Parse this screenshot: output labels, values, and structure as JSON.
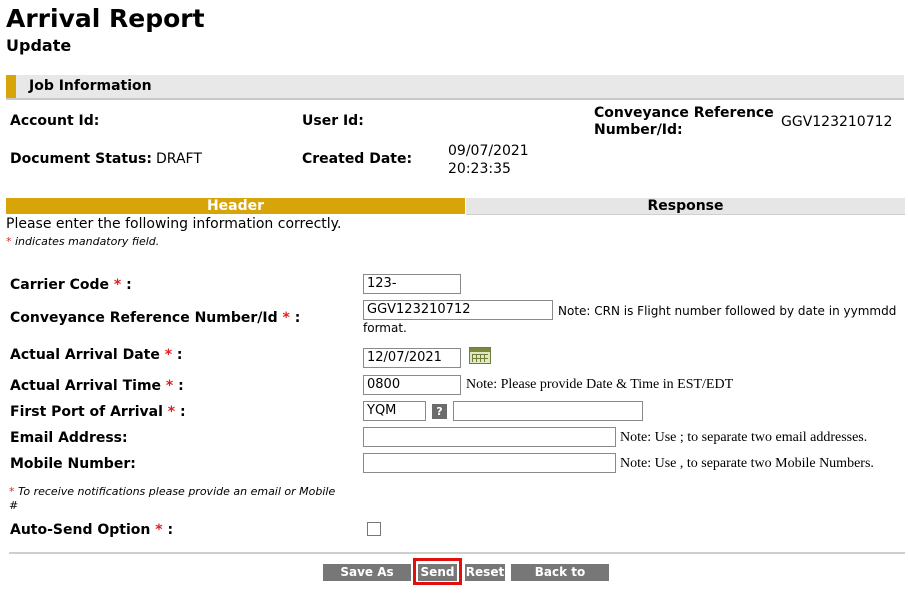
{
  "page": {
    "title": "Arrival Report",
    "subtitle": "Update"
  },
  "job_info": {
    "section_title": "Job Information",
    "account_id_label": "Account Id:",
    "account_id_value": "",
    "user_id_label": "User Id:",
    "user_id_value": "",
    "conveyance_label_line1": "Conveyance Reference",
    "conveyance_label_line2": "Number/Id:",
    "conveyance_value": "GGV123210712",
    "doc_status_label": "Document Status:",
    "doc_status_value": "DRAFT",
    "created_date_label": "Created Date:",
    "created_date_line1": "09/07/2021",
    "created_date_line2": "20:23:35"
  },
  "tabs": {
    "header": "Header",
    "response": "Response"
  },
  "form": {
    "instructions": "Please enter the following information correctly.",
    "mandatory_star": "*",
    "mandatory_note": " indicates mandatory field.",
    "carrier_code_label": "Carrier Code",
    "carrier_code_value": "123-",
    "crn_label": "Conveyance Reference Number/Id",
    "crn_value": "GGV123210712",
    "crn_note_line1": "Note: CRN is Flight number followed by date in yymmdd",
    "crn_note_line2": "format.",
    "arrival_date_label": "Actual Arrival Date",
    "arrival_date_value": "12/07/2021",
    "arrival_time_label": "Actual Arrival Time",
    "arrival_time_value": "0800",
    "arrival_time_note": "Note: Please provide Date & Time in EST/EDT",
    "port_label": "First Port of Arrival",
    "port_value": "YQM",
    "port_desc_value": "",
    "help_icon_glyph": "?",
    "email_label": "Email Address:",
    "email_value": "",
    "email_note": "Note: Use ; to separate two email addresses.",
    "mobile_label": "Mobile Number:",
    "mobile_value": "",
    "mobile_note": "Note: Use , to separate two Mobile Numbers.",
    "notif_note_line1": " To receive notifications please provide an email or Mobile",
    "notif_note_line2": "#",
    "auto_send_label": "Auto-Send Option",
    "auto_send_checked": false,
    "star": "*",
    "colon": " :"
  },
  "buttons": {
    "save_draft": "Save As Draft",
    "send": "Send",
    "reset": "Reset",
    "back": "Back to Search"
  },
  "colors": {
    "accent": "#d7a508",
    "button": "#777777",
    "highlight": "#e01010",
    "required": "#e02020"
  }
}
